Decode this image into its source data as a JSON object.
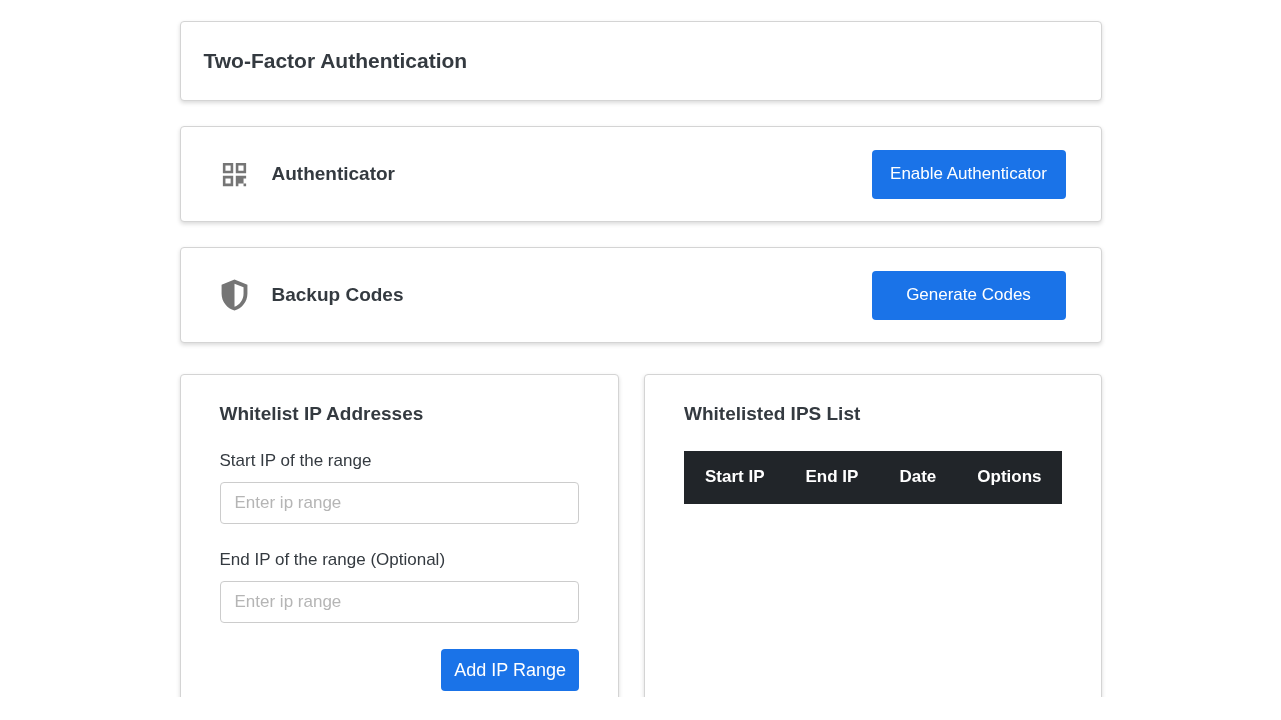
{
  "header": {
    "title": "Two-Factor Authentication"
  },
  "methods": [
    {
      "kind": "qr",
      "title": "Authenticator",
      "button": "Enable Authenticator"
    },
    {
      "kind": "shield",
      "title": "Backup Codes",
      "button": "Generate Codes"
    }
  ],
  "whitelist_form": {
    "title": "Whitelist IP Addresses",
    "fields": [
      {
        "label": "Start IP of the range",
        "placeholder": "Enter ip range"
      },
      {
        "label": "End IP of the range (Optional)",
        "placeholder": "Enter ip range"
      }
    ],
    "button": "Add IP Range"
  },
  "whitelist_table": {
    "title": "Whitelisted IPS List",
    "columns": [
      "Start IP",
      "End IP",
      "Date",
      "Options"
    ]
  }
}
